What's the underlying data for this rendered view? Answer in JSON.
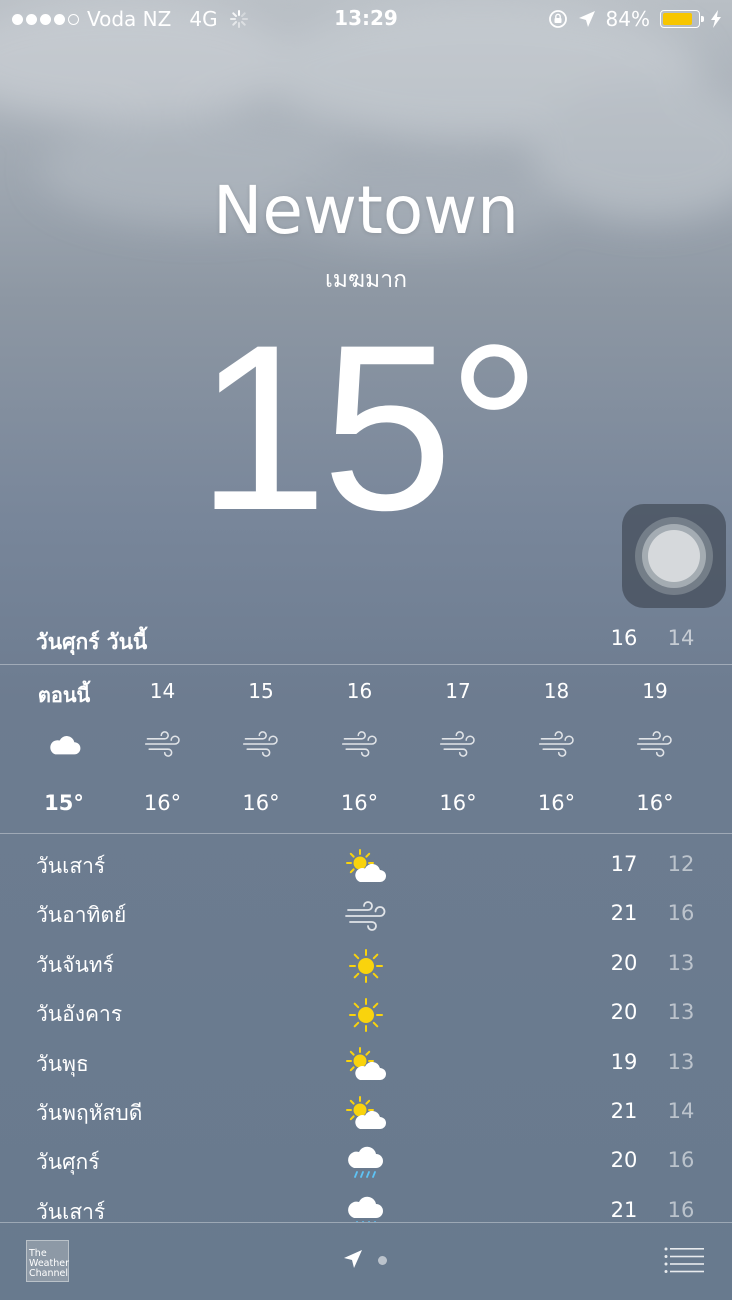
{
  "status_bar": {
    "carrier": "Voda NZ",
    "network": "4G",
    "time": "13:29",
    "battery_percent": "84%",
    "battery_level": 0.84,
    "signal_bars": 4,
    "signal_max": 5,
    "icons": [
      "loading-spinner-icon",
      "rotation-lock-icon",
      "location-arrow-icon",
      "charging-bolt-icon"
    ]
  },
  "location": {
    "city": "Newtown",
    "condition": "เมฆมาก",
    "current_temp": "15",
    "degree_symbol": "°"
  },
  "today": {
    "label": "วันศุกร์  วันนี้",
    "high": "16",
    "low": "14"
  },
  "hourly": [
    {
      "time": "ตอนนี้",
      "icon": "cloud-icon",
      "temp": "15°"
    },
    {
      "time": "14",
      "icon": "wind-icon",
      "temp": "16°"
    },
    {
      "time": "15",
      "icon": "wind-icon",
      "temp": "16°"
    },
    {
      "time": "16",
      "icon": "wind-icon",
      "temp": "16°"
    },
    {
      "time": "17",
      "icon": "wind-icon",
      "temp": "16°"
    },
    {
      "time": "18",
      "icon": "wind-icon",
      "temp": "16°"
    },
    {
      "time": "19",
      "icon": "wind-icon",
      "temp": "16°"
    }
  ],
  "daily": [
    {
      "day": "วันเสาร์",
      "icon": "partly-cloudy-icon",
      "high": "17",
      "low": "12"
    },
    {
      "day": "วันอาทิตย์",
      "icon": "wind-icon",
      "high": "21",
      "low": "16"
    },
    {
      "day": "วันจันทร์",
      "icon": "sun-icon",
      "high": "20",
      "low": "13"
    },
    {
      "day": "วันอังคาร",
      "icon": "sun-icon",
      "high": "20",
      "low": "13"
    },
    {
      "day": "วันพุธ",
      "icon": "partly-cloudy-icon",
      "high": "19",
      "low": "13"
    },
    {
      "day": "วันพฤหัสบดี",
      "icon": "partly-cloudy-icon",
      "high": "21",
      "low": "14"
    },
    {
      "day": "วันศุกร์",
      "icon": "rain-icon",
      "high": "20",
      "low": "16"
    },
    {
      "day": "วันเสาร์",
      "icon": "rain-icon",
      "high": "21",
      "low": "16"
    }
  ],
  "footer": {
    "logo_text": "The Weather Channel",
    "logo_lines": [
      "The",
      "Weather",
      "Channel"
    ]
  },
  "colors": {
    "battery_fill": "#f7c600",
    "sun": "#f9d30d"
  }
}
